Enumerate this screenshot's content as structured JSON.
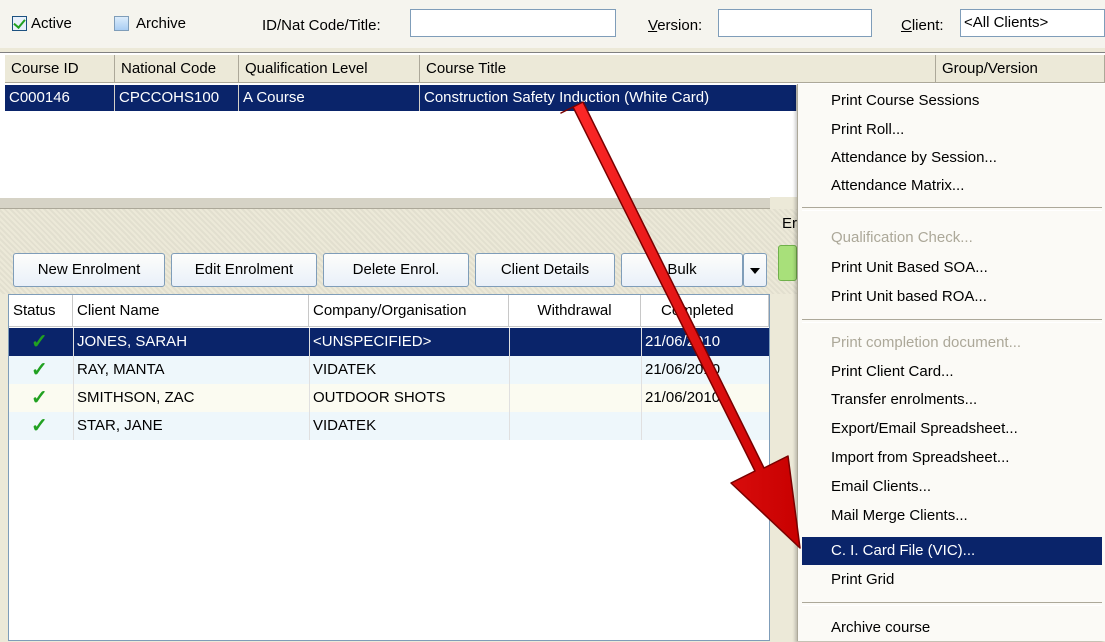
{
  "filters": {
    "active_label": "Active",
    "archive_label": "Archive",
    "id_label": "ID/Nat Code/Title:",
    "id_value": "",
    "version_label_u": "V",
    "version_label_rest": "ersion:",
    "version_value": "",
    "client_label_u": "C",
    "client_label_rest": "lient:",
    "client_value": "<All Clients>"
  },
  "courses": {
    "columns": [
      "Course ID",
      "National Code",
      "Qualification Level",
      "Course Title",
      "Group/Version"
    ],
    "rows": [
      {
        "course_id": "C000146",
        "national_code": "CPCCOHS100",
        "qualification_level": "A Course",
        "course_title": "Construction Safety Induction (White Card)",
        "group_version": ""
      }
    ]
  },
  "side_label": "Er",
  "toolbar": {
    "new_enrolment": "New Enrolment",
    "edit_enrolment": "Edit Enrolment",
    "delete_enrol": "Delete Enrol.",
    "client_details": "Client Details",
    "bulk": "Bulk",
    "dropdown_arrow": "chevron-down-icon"
  },
  "enrolments": {
    "columns": [
      "Status",
      "Client Name",
      "Company/Organisation",
      "Withdrawal",
      "Completed"
    ],
    "rows": [
      {
        "status": "✓",
        "client_name": "JONES, SARAH",
        "company": "<UNSPECIFIED>",
        "withdrawal": "",
        "completed": "21/06/2010"
      },
      {
        "status": "✓",
        "client_name": "RAY, MANTA",
        "company": "VIDATEK",
        "withdrawal": "",
        "completed": "21/06/2010"
      },
      {
        "status": "✓",
        "client_name": "SMITHSON, ZAC",
        "company": "OUTDOOR SHOTS",
        "withdrawal": "",
        "completed": "21/06/2010"
      },
      {
        "status": "✓",
        "client_name": "STAR, JANE",
        "company": "VIDATEK",
        "withdrawal": "",
        "completed": ""
      }
    ]
  },
  "context_menu": {
    "items": [
      "Print Course Sessions",
      "Print Roll...",
      "Attendance by Session...",
      "Attendance Matrix...",
      "Qualification Check...",
      "Print Unit Based SOA...",
      "Print Unit based ROA...",
      "Print completion document...",
      "Print Client Card...",
      "Transfer enrolments...",
      "Export/Email Spreadsheet...",
      "Import from Spreadsheet...",
      "Email Clients...",
      "Mail Merge Clients...",
      "C. I. Card File (VIC)...",
      "Print Grid",
      "Archive course"
    ],
    "disabled": [
      "Qualification Check...",
      "Print completion document..."
    ],
    "highlighted": "C. I. Card File (VIC)..."
  },
  "colors": {
    "selection": "#0a246a",
    "arrow": "#e00000",
    "check": "#21a121"
  }
}
